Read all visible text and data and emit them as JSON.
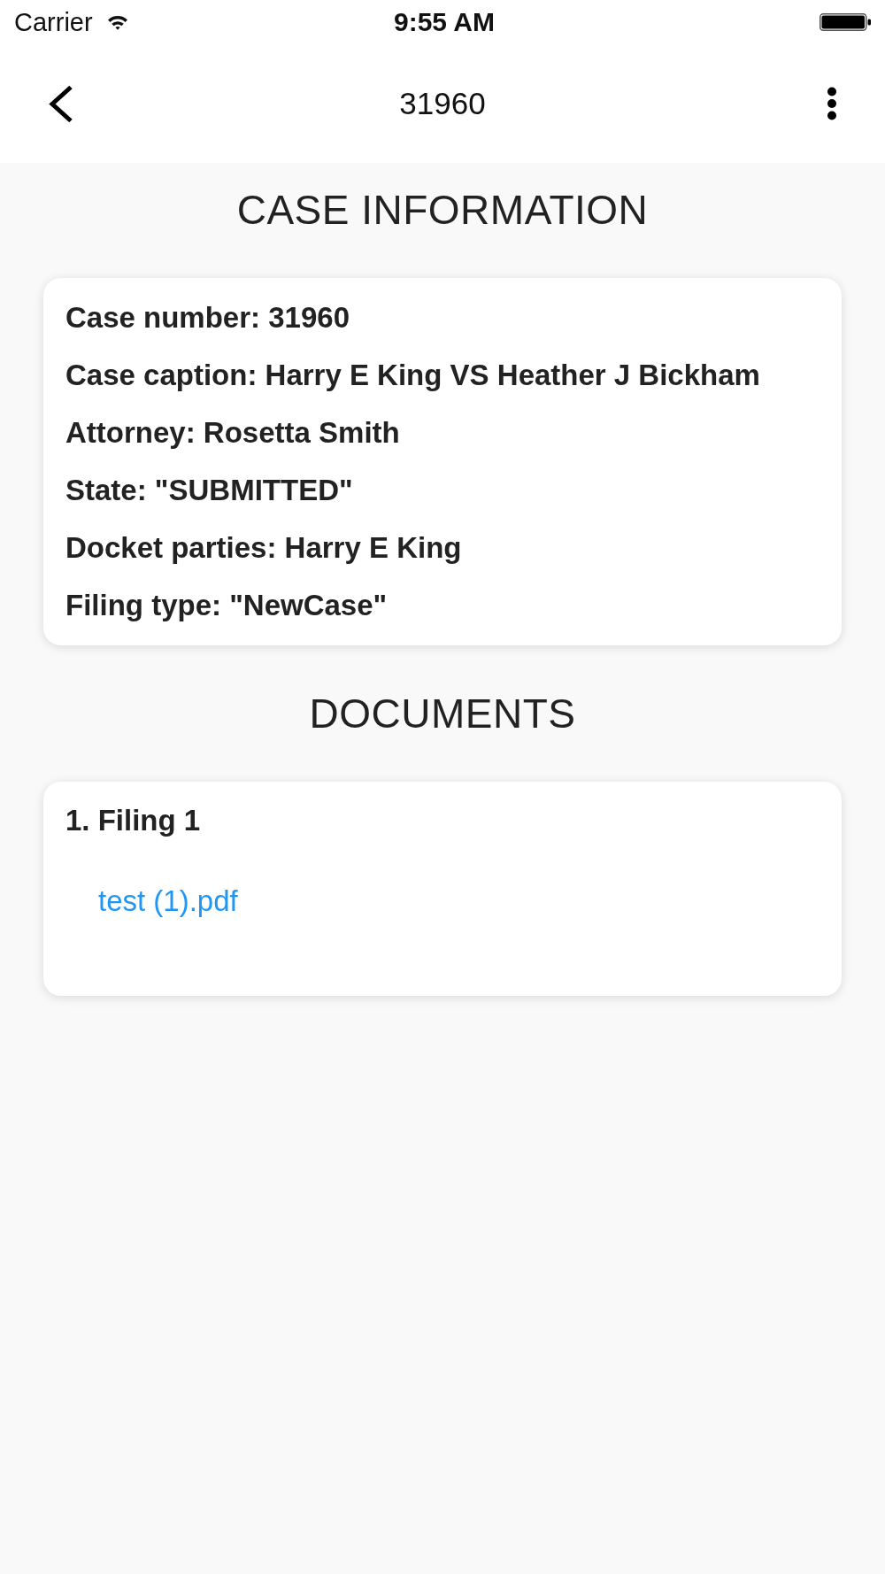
{
  "status_bar": {
    "carrier": "Carrier",
    "time": "9:55 AM"
  },
  "nav_bar": {
    "title": "31960"
  },
  "case_information": {
    "heading": "CASE INFORMATION",
    "lines": [
      "Case number: 31960",
      "Case caption: Harry E King VS Heather J Bickham",
      "Attorney: Rosetta Smith",
      "State: \"SUBMITTED\"",
      "Docket parties: Harry E King",
      "Filing type: \"NewCase\""
    ]
  },
  "documents": {
    "heading": "DOCUMENTS",
    "filings": [
      {
        "title": "1. Filing 1",
        "files": [
          "test (1).pdf"
        ]
      }
    ]
  }
}
